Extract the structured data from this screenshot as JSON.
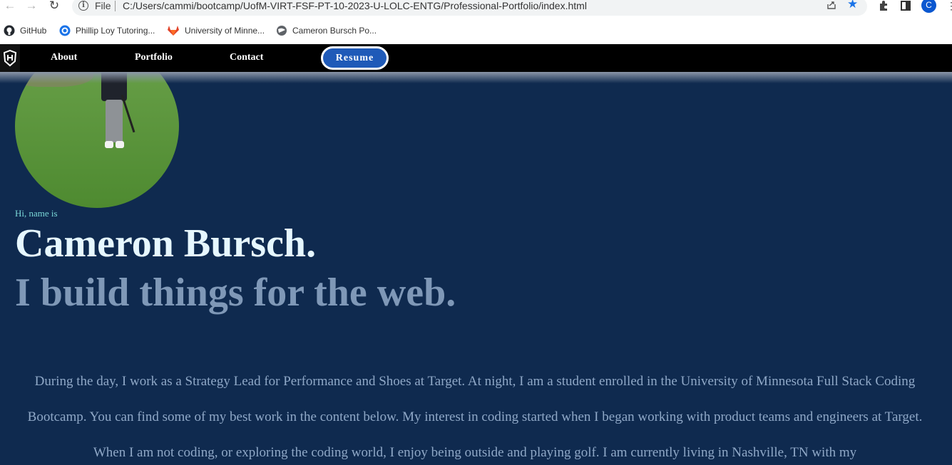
{
  "browser": {
    "file_label": "File",
    "url": "C:/Users/cammi/bootcamp/UofM-VIRT-FSF-PT-10-2023-U-LOLC-ENTG/Professional-Portfolio/index.html",
    "profile_initial": "C",
    "back_icon": "arrow-left-icon",
    "forward_icon": "arrow-right-icon",
    "reload_icon": "reload-icon"
  },
  "bookmarks": [
    {
      "label": "GitHub",
      "icon": "github-icon",
      "color": "#24292f"
    },
    {
      "label": "Phillip Loy Tutoring...",
      "icon": "globe-blue-icon",
      "color": "#1a73e8"
    },
    {
      "label": "University of Minne...",
      "icon": "gitlab-icon",
      "color": "#e24329"
    },
    {
      "label": "Cameron Bursch Po...",
      "icon": "globe-icon",
      "color": "#5f6368"
    }
  ],
  "site_nav": {
    "links": [
      "About",
      "Portfolio",
      "Contact"
    ],
    "resume_label": "Resume",
    "accent": "#1f5ab8"
  },
  "hero": {
    "greeting": "Hi, name is",
    "name": "Cameron Bursch.",
    "tagline": "I build things for the web.",
    "bio": "During the day, I work as a Strategy Lead for Performance and Shoes at Target. At night, I am a student enrolled in the University of Minnesota Full Stack Coding Bootcamp. You can find some of my best work in the content below. My interest in coding started when I began working with product teams and engineers at Target. When I am not coding, or exploring the coding world, I enjoy being outside and playing golf. I am currently living in Nashville, TN with my"
  },
  "colors": {
    "page_bg": "#0f2a4f",
    "name_color": "#e6f7ff",
    "tagline_color": "#7f98b7",
    "greeting_color": "#7ad7d7"
  }
}
